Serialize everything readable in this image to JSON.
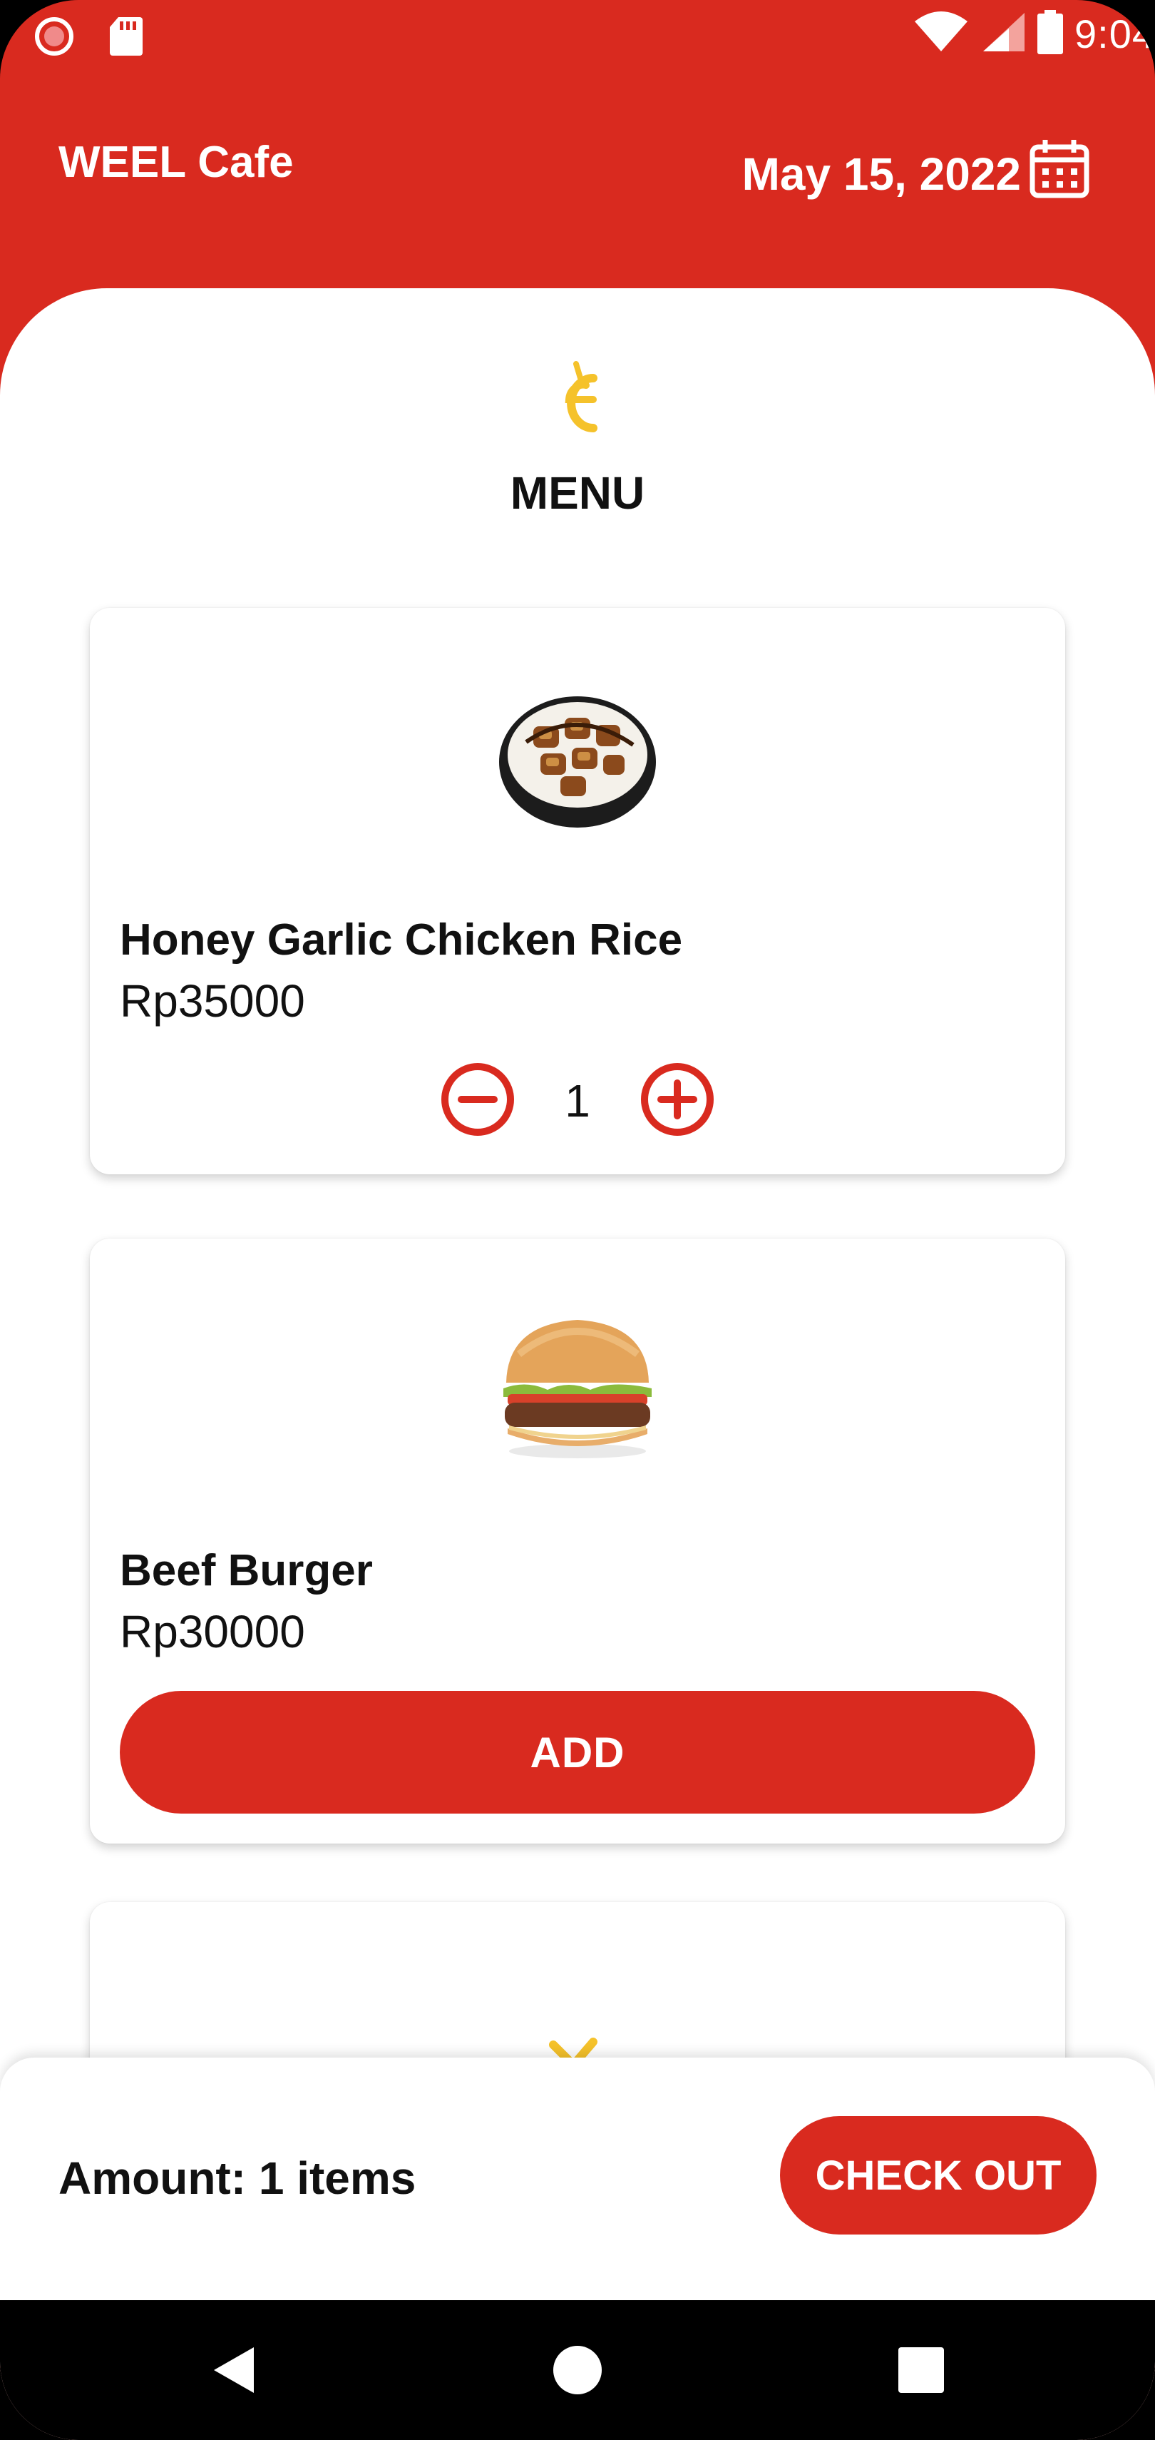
{
  "status_bar": {
    "time": "9:04"
  },
  "header": {
    "app_title": "WEEL Cafe",
    "date": "May 15, 2022"
  },
  "page_title": "MENU",
  "menu_items": [
    {
      "name": "Honey Garlic Chicken Rice",
      "price": "Rp35000",
      "quantity": "1",
      "image_icon": "chicken-rice-bowl-icon"
    },
    {
      "name": "Beef Burger",
      "price": "Rp30000",
      "add_label": "ADD",
      "image_icon": "burger-icon"
    }
  ],
  "footer": {
    "amount_text": "Amount: 1 items",
    "checkout_label": "CHECK OUT"
  },
  "colors": {
    "primary": "#d92a1f",
    "logo": "#f5c22b",
    "background": "#ffffff"
  }
}
